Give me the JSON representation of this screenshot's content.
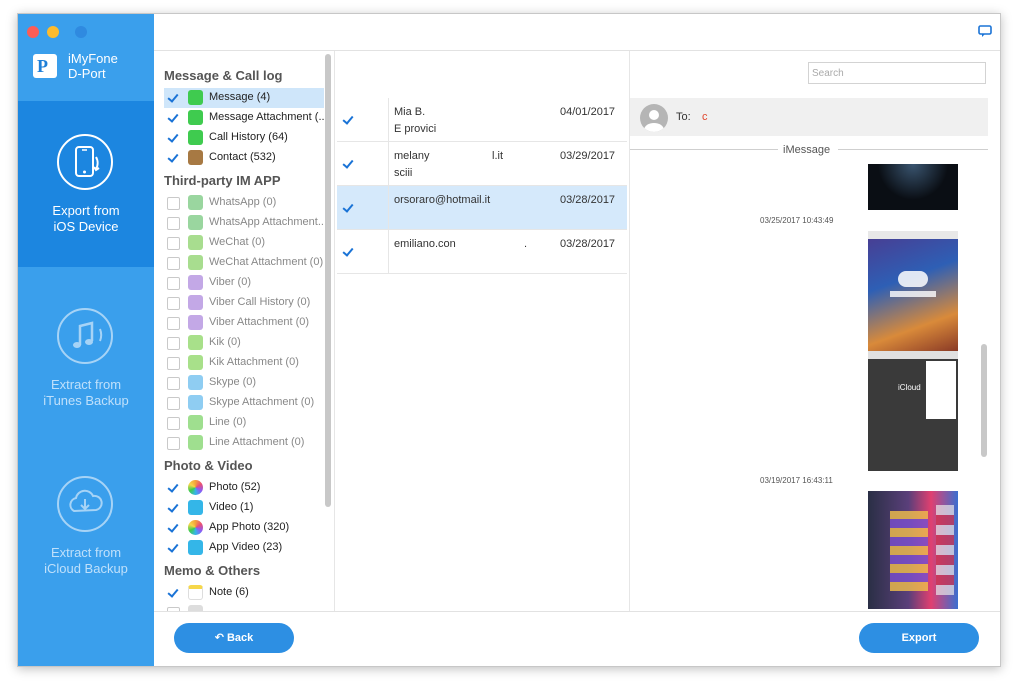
{
  "window": {
    "controls": [
      "close",
      "minimize",
      "zoom"
    ]
  },
  "app": {
    "name_line1": "iMyFone",
    "name_line2": "D-Port",
    "logo_letter": "P"
  },
  "nav": [
    {
      "line1": "Export from",
      "line2": "iOS Device",
      "active": true,
      "icon": "phone-export-icon"
    },
    {
      "line1": "Extract from",
      "line2": "iTunes Backup",
      "active": false,
      "icon": "music-note-icon"
    },
    {
      "line1": "Extract from",
      "line2": "iCloud Backup",
      "active": false,
      "icon": "cloud-download-icon"
    }
  ],
  "categories": {
    "groups": [
      {
        "title": "Message & Call log",
        "items": [
          {
            "label": "Message (4)",
            "checked": true,
            "selected": true,
            "icon": "message-icon",
            "color": "#3fcb4f"
          },
          {
            "label": "Message Attachment (...",
            "checked": true,
            "icon": "message-attachment-icon",
            "color": "#3fcb4f"
          },
          {
            "label": "Call History (64)",
            "checked": true,
            "icon": "phone-icon",
            "color": "#3fcb4f"
          },
          {
            "label": "Contact (532)",
            "checked": true,
            "icon": "contact-icon",
            "color": "#a77943"
          }
        ]
      },
      {
        "title": "Third-party IM APP",
        "items": [
          {
            "label": "WhatsApp (0)",
            "checked": false,
            "disabled": true,
            "icon": "whatsapp-icon",
            "color": "#9ad69f"
          },
          {
            "label": "WhatsApp Attachment...",
            "checked": false,
            "disabled": true,
            "icon": "whatsapp-attachment-icon",
            "color": "#9ad69f"
          },
          {
            "label": "WeChat (0)",
            "checked": false,
            "disabled": true,
            "icon": "wechat-icon",
            "color": "#a8dd8f"
          },
          {
            "label": "WeChat Attachment (0)",
            "checked": false,
            "disabled": true,
            "icon": "wechat-attachment-icon",
            "color": "#a8dd8f"
          },
          {
            "label": "Viber (0)",
            "checked": false,
            "disabled": true,
            "icon": "viber-icon",
            "color": "#c3a8e6"
          },
          {
            "label": "Viber Call History (0)",
            "checked": false,
            "disabled": true,
            "icon": "viber-call-icon",
            "color": "#c3a8e6"
          },
          {
            "label": "Viber Attachment (0)",
            "checked": false,
            "disabled": true,
            "icon": "viber-attachment-icon",
            "color": "#c3a8e6"
          },
          {
            "label": "Kik (0)",
            "checked": false,
            "disabled": true,
            "icon": "kik-icon",
            "color": "#a8e08a"
          },
          {
            "label": "Kik Attachment (0)",
            "checked": false,
            "disabled": true,
            "icon": "kik-attachment-icon",
            "color": "#a8e08a"
          },
          {
            "label": "Skype (0)",
            "checked": false,
            "disabled": true,
            "icon": "skype-icon",
            "color": "#8fcdf2"
          },
          {
            "label": "Skype Attachment (0)",
            "checked": false,
            "disabled": true,
            "icon": "skype-attachment-icon",
            "color": "#8fcdf2"
          },
          {
            "label": "Line (0)",
            "checked": false,
            "disabled": true,
            "icon": "line-icon",
            "color": "#9fdf8f"
          },
          {
            "label": "Line Attachment (0)",
            "checked": false,
            "disabled": true,
            "icon": "line-attachment-icon",
            "color": "#9fdf8f"
          }
        ]
      },
      {
        "title": "Photo & Video",
        "items": [
          {
            "label": "Photo (52)",
            "checked": true,
            "icon": "photos-icon",
            "color": "#f4a23b"
          },
          {
            "label": "Video (1)",
            "checked": true,
            "icon": "video-icon",
            "color": "#34b6e8"
          },
          {
            "label": "App Photo (320)",
            "checked": true,
            "icon": "app-photo-icon",
            "color": "#f4a23b"
          },
          {
            "label": "App Video (23)",
            "checked": true,
            "icon": "app-video-icon",
            "color": "#34b6e8"
          }
        ]
      },
      {
        "title": "Memo & Others",
        "items": [
          {
            "label": "Note (6)",
            "checked": true,
            "icon": "note-icon",
            "color": "#f6d74a"
          },
          {
            "label": "",
            "checked": false,
            "icon": "voice-memo-icon",
            "color": "#dddddd"
          }
        ]
      }
    ]
  },
  "messages": [
    {
      "name": "Mia B.",
      "preview": "E provici",
      "date": "04/01/2017",
      "checked": true,
      "selected": false
    },
    {
      "name": "melany",
      "name_suffix": "l.it",
      "preview": "sciii",
      "date": "03/29/2017",
      "checked": true,
      "selected": false
    },
    {
      "name": "orsoraro@hotmail.it",
      "preview": "",
      "date": "03/28/2017",
      "checked": true,
      "selected": true
    },
    {
      "name": "emiliano.con",
      "name_suffix": ".",
      "preview": "",
      "date": "03/28/2017",
      "checked": true,
      "selected": false
    }
  ],
  "search": {
    "placeholder": "Search"
  },
  "conversation": {
    "to_label": "To:",
    "to_value": "c",
    "service": "iMessage",
    "timestamps": [
      "03/25/2017 10:43:49",
      "03/19/2017 16:43:11"
    ],
    "icloud_label": "iCloud"
  },
  "buttons": {
    "back": "Back",
    "export": "Export"
  },
  "colors": {
    "sidebar": "#3a9fec",
    "sidebar_active": "#1c86e0",
    "accent": "#2d8fe3",
    "selected_row": "#d5e9fb"
  }
}
